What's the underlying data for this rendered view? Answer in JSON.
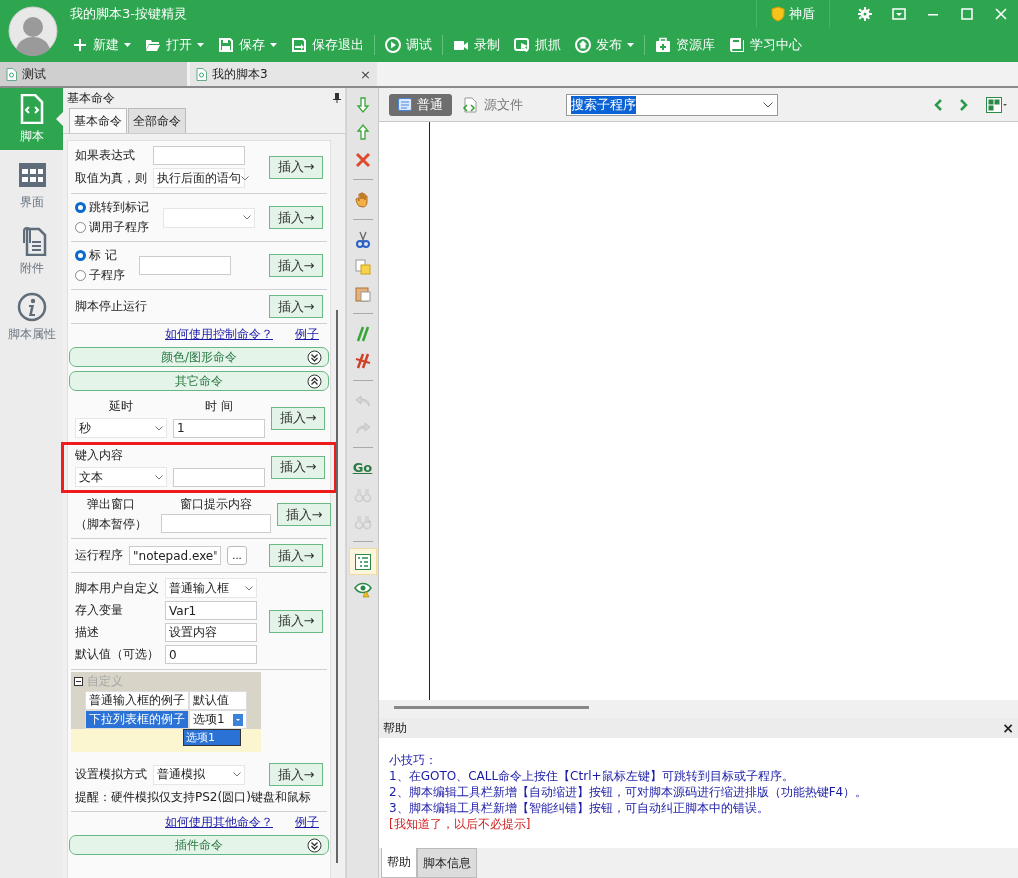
{
  "window": {
    "title": "我的脚本3-按键精灵",
    "shield_label": "神盾"
  },
  "toolbar": [
    {
      "kind": "new",
      "label": "新建",
      "dropdown": true
    },
    {
      "kind": "open",
      "label": "打开",
      "dropdown": true
    },
    {
      "kind": "save",
      "label": "保存",
      "dropdown": true
    },
    {
      "kind": "save-exit",
      "label": "保存退出",
      "dropdown": false
    },
    {
      "kind": "separator"
    },
    {
      "kind": "debug",
      "label": "调试",
      "dropdown": false
    },
    {
      "kind": "separator"
    },
    {
      "kind": "record",
      "label": "录制",
      "dropdown": false
    },
    {
      "kind": "capture",
      "label": "抓抓",
      "dropdown": false
    },
    {
      "kind": "publish",
      "label": "发布",
      "dropdown": true
    },
    {
      "kind": "separator"
    },
    {
      "kind": "library",
      "label": "资源库",
      "dropdown": false
    },
    {
      "kind": "learn",
      "label": "学习中心",
      "dropdown": false
    }
  ],
  "document_tabs": [
    {
      "label": "测试",
      "selected": false
    },
    {
      "label": "我的脚本3",
      "selected": true,
      "close": "×"
    }
  ],
  "nav": [
    {
      "kind": "script",
      "label": "脚本",
      "selected": true
    },
    {
      "kind": "grid",
      "label": "界面",
      "selected": false
    },
    {
      "kind": "attachment",
      "label": "附件",
      "selected": false
    },
    {
      "kind": "info",
      "label": "脚本属性",
      "selected": false
    }
  ],
  "command_panel": {
    "title": "基本命令",
    "tabs": [
      {
        "label": "基本命令",
        "selected": true
      },
      {
        "label": "全部命令",
        "selected": false
      }
    ],
    "blocks": [
      {
        "kind": "form",
        "lines": [
          [
            {
              "kind": "label",
              "text": "如果表达式"
            },
            {
              "kind": "field"
            }
          ],
          [
            {
              "kind": "label",
              "text": "取值为真，则"
            },
            {
              "kind": "select",
              "value": "执行后面的语句"
            }
          ]
        ],
        "button": "插入→"
      },
      {
        "kind": "form",
        "lines": [
          [
            {
              "kind": "radio",
              "text": "跳转到标记",
              "selected": true
            }
          ],
          [
            {
              "kind": "radio",
              "text": "调用子程序",
              "selected": false
            }
          ]
        ],
        "middle": {
          "kind": "select"
        },
        "button": "插入→"
      },
      {
        "kind": "form",
        "lines": [
          [
            {
              "kind": "radio",
              "text": "标 记",
              "selected": true
            }
          ],
          [
            {
              "kind": "radio",
              "text": "子程序",
              "selected": false
            }
          ]
        ],
        "middle": {
          "kind": "field"
        },
        "button": "插入→"
      },
      {
        "kind": "form",
        "lines": [
          [
            {
              "kind": "label",
              "text": "脚本停止运行"
            }
          ]
        ],
        "button": "插入→"
      },
      {
        "kind": "links",
        "links": [
          "如何使用控制命令？",
          "例子"
        ]
      },
      {
        "kind": "group",
        "label": "颜色/图形命令",
        "expanded": false
      },
      {
        "kind": "group",
        "label": "其它命令",
        "expanded": true
      },
      {
        "kind": "form",
        "lines": [
          [
            {
              "kind": "caption",
              "text": "延时"
            },
            {
              "kind": "caption",
              "text": "时 间"
            }
          ],
          [
            {
              "kind": "select",
              "value": "秒"
            },
            {
              "kind": "field",
              "value": "1"
            }
          ]
        ],
        "button": "插入→"
      },
      {
        "kind": "form",
        "highlighted": true,
        "lines": [
          [
            {
              "kind": "label",
              "text": "键入内容"
            }
          ],
          [
            {
              "kind": "select",
              "value": "文本"
            },
            {
              "kind": "field"
            }
          ]
        ],
        "button": "插入→"
      },
      {
        "kind": "form",
        "lines": [
          [
            {
              "kind": "caption",
              "text": "弹出窗口"
            }
          ],
          [
            {
              "kind": "caption",
              "text": "（脚本暂停）"
            }
          ]
        ],
        "middle": {
          "kind": "captioned_field",
          "caption": "窗口提示内容"
        },
        "button": "插入→"
      },
      {
        "kind": "form",
        "lines": [
          [
            {
              "kind": "label",
              "text": "运行程序"
            },
            {
              "kind": "field",
              "value": "\"notepad.exe\""
            },
            {
              "kind": "browse",
              "text": "..."
            }
          ]
        ],
        "button": "插入→"
      },
      {
        "kind": "form",
        "lines": [
          [
            {
              "kind": "label",
              "text": "脚本用户自定义"
            },
            {
              "kind": "select",
              "value": "普通输入框"
            }
          ],
          [
            {
              "kind": "label",
              "text": "存入变量"
            },
            {
              "kind": "field",
              "value": "Var1"
            }
          ],
          [
            {
              "kind": "label",
              "text": "描述"
            },
            {
              "kind": "field",
              "value": "设置内容"
            }
          ],
          [
            {
              "kind": "label",
              "text": "默认值（可选）"
            },
            {
              "kind": "field",
              "value": "0"
            }
          ]
        ],
        "button": "插入→"
      },
      {
        "kind": "preview",
        "title": "自定义",
        "rows": [
          {
            "cells": [
              "普通输入框的例子",
              "默认值"
            ],
            "selected": false
          },
          {
            "cells": [
              "下拉列表框的例子",
              "选项1"
            ],
            "selected": true
          }
        ],
        "dropdown_item": "选项1"
      },
      {
        "kind": "form",
        "lines": [
          [
            {
              "kind": "label",
              "text": "设置模拟方式"
            },
            {
              "kind": "select",
              "value": "普通模拟"
            }
          ]
        ],
        "button": "插入→",
        "note": "提醒：硬件模拟仅支持PS2(圆口)键盘和鼠标"
      },
      {
        "kind": "links",
        "links": [
          "如何使用其他命令？",
          "例子"
        ]
      },
      {
        "kind": "group",
        "label": "插件命令",
        "expanded": false
      }
    ]
  },
  "edit_toolbar": [
    {
      "kind": "move-down",
      "disabled": false
    },
    {
      "kind": "move-up",
      "disabled": false
    },
    {
      "kind": "delete",
      "disabled": false
    },
    {
      "kind": "separator"
    },
    {
      "kind": "hand",
      "disabled": false
    },
    {
      "kind": "separator"
    },
    {
      "kind": "cut",
      "disabled": false
    },
    {
      "kind": "copy",
      "disabled": false
    },
    {
      "kind": "paste",
      "disabled": false
    },
    {
      "kind": "separator"
    },
    {
      "kind": "comment",
      "disabled": false
    },
    {
      "kind": "uncomment",
      "disabled": false
    },
    {
      "kind": "separator"
    },
    {
      "kind": "undo",
      "disabled": true
    },
    {
      "kind": "redo",
      "disabled": true
    },
    {
      "kind": "separator"
    },
    {
      "kind": "goto",
      "label": "Go",
      "disabled": false
    },
    {
      "kind": "find",
      "disabled": true
    },
    {
      "kind": "replace",
      "disabled": true
    },
    {
      "kind": "separator"
    },
    {
      "kind": "indent",
      "disabled": false,
      "selected": true
    },
    {
      "kind": "check",
      "disabled": false
    }
  ],
  "editor": {
    "view_tabs": [
      {
        "label": "普通",
        "selected": true
      },
      {
        "label": "源文件",
        "selected": false
      }
    ],
    "search": {
      "value": "搜索子程序"
    }
  },
  "help": {
    "title": "帮助",
    "close": "×",
    "heading": "小技巧：",
    "tips": [
      "1、在GOTO、CALL命令上按住【Ctrl+鼠标左键】可跳转到目标或子程序。",
      "2、脚本编辑工具栏新增【自动缩进】按钮，可对脚本源码进行缩进排版（功能热键F4）。",
      "3、脚本编辑工具栏新增【智能纠错】按钮，可自动纠正脚本中的错误。"
    ],
    "dismiss": "[我知道了，以后不必提示]",
    "tabs": [
      {
        "label": "帮助",
        "selected": true
      },
      {
        "label": "脚本信息",
        "selected": false
      }
    ]
  }
}
